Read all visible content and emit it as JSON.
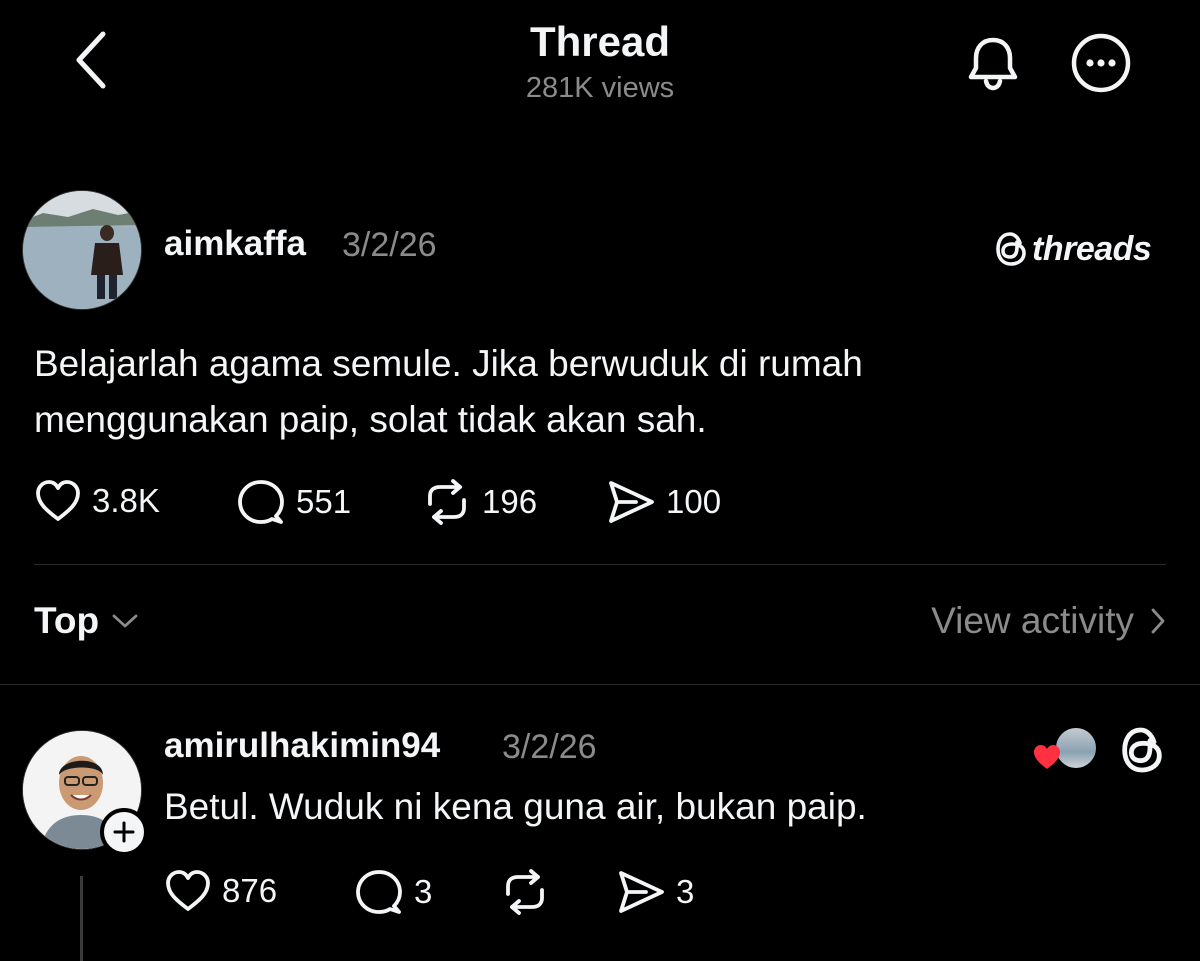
{
  "header": {
    "title": "Thread",
    "views": "281K views"
  },
  "post": {
    "username": "aimkaffa",
    "date": "3/2/26",
    "brand": "threads",
    "text_line1": "Belajarlah agama semule. Jika berwuduk di rumah",
    "text_line2": "menggunakan paip, solat tidak akan sah.",
    "likes": "3.8K",
    "replies": "551",
    "reposts": "196",
    "shares": "100"
  },
  "sort": {
    "label": "Top",
    "view_activity": "View activity"
  },
  "reply": {
    "username": "amirulhakimin94",
    "date": "3/2/26",
    "text": "Betul. Wuduk ni kena guna air, bukan paip.",
    "likes": "876",
    "replies": "3",
    "reposts": "",
    "shares": "3"
  },
  "colors": {
    "background": "#000000",
    "primary_text": "#f3f5f7",
    "secondary_text": "#8b8b8b",
    "heart_red": "#ff3040"
  },
  "icons": {
    "back": "chevron-left-icon",
    "bell": "bell-icon",
    "more": "ellipsis-circle-icon",
    "like": "heart-icon",
    "comment": "speech-bubble-icon",
    "repost": "repost-icon",
    "share": "paper-plane-icon",
    "sort": "chevron-down-icon",
    "activity": "chevron-right-icon",
    "follow": "plus-icon",
    "brand": "threads-logo-icon"
  }
}
